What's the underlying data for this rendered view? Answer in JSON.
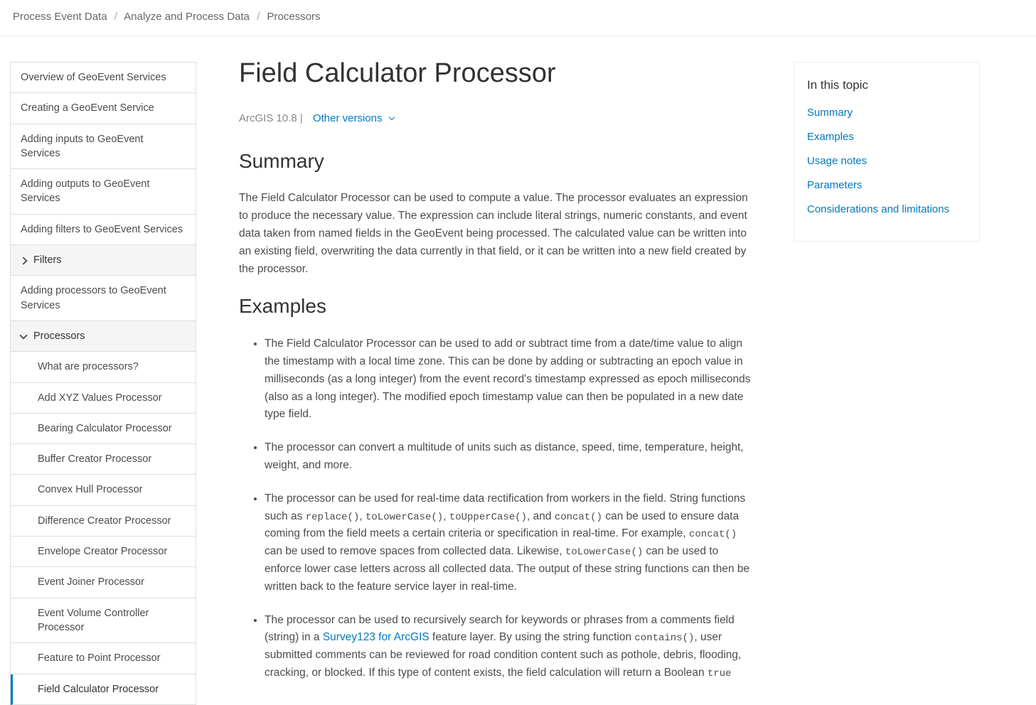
{
  "breadcrumb": {
    "a": "Process Event Data",
    "b": "Analyze and Process Data",
    "c": "Processors"
  },
  "sidebar": {
    "items": [
      "Overview of GeoEvent Services",
      "Creating a GeoEvent Service",
      "Adding inputs to GeoEvent Services",
      "Adding outputs to GeoEvent Services",
      "Adding filters to GeoEvent Services"
    ],
    "filters_label": "Filters",
    "add_proc_label": "Adding processors to GeoEvent Services",
    "processors_label": "Processors",
    "subs": [
      "What are processors?",
      "Add XYZ Values Processor",
      "Bearing Calculator Processor",
      "Buffer Creator Processor",
      "Convex Hull Processor",
      "Difference Creator Processor",
      "Envelope Creator Processor",
      "Event Joiner Processor",
      "Event Volume Controller Processor",
      "Feature to Point Processor",
      "Field Calculator Processor"
    ]
  },
  "main": {
    "title": "Field Calculator Processor",
    "version": "ArcGIS 10.8",
    "other_versions": "Other versions",
    "summary_h": "Summary",
    "summary_p": "The Field Calculator Processor can be used to compute a value. The processor evaluates an expression to produce the necessary value. The expression can include literal strings, numeric constants, and event data taken from named fields in the GeoEvent being processed. The calculated value can be written into an existing field, overwriting the data currently in that field, or it can be written into a new field created by the processor.",
    "examples_h": "Examples",
    "ex1": "The Field Calculator Processor can be used to add or subtract time from a date/time value to align the timestamp with a local time zone. This can be done by adding or subtracting an epoch value in milliseconds (as a long integer) from the event record's timestamp expressed as epoch milliseconds (also as a long integer). The modified epoch timestamp value can then be populated in a new date type field.",
    "ex2": "The processor can convert a multitude of units such as distance, speed, time, temperature, height, weight, and more.",
    "ex3_a": "The processor can be used for real-time data rectification from workers in the field. String functions such as ",
    "ex3_code1": "replace()",
    "ex3_b": ", ",
    "ex3_code2": "toLowerCase()",
    "ex3_c": ", ",
    "ex3_code3": "toUpperCase()",
    "ex3_d": ", and ",
    "ex3_code4": "concat()",
    "ex3_e": " can be used to ensure data coming from the field meets a certain criteria or specification in real-time. For example, ",
    "ex3_code5": "concat()",
    "ex3_f": " can be used to remove spaces from collected data. Likewise, ",
    "ex3_code6": "toLowerCase()",
    "ex3_g": " can be used to enforce lower case letters across all collected data. The output of these string functions can then be written back to the feature service layer in real-time.",
    "ex4_a": "The processor can be used to recursively search for keywords or phrases from a comments field (string) in a ",
    "ex4_link": "Survey123 for ArcGIS",
    "ex4_b": " feature layer. By using the string function ",
    "ex4_code1": "contains()",
    "ex4_c": ", user submitted comments can be reviewed for road condition content such as pothole, debris, flooding, cracking, or blocked. If this type of content exists, the field calculation will return a Boolean ",
    "ex4_code2": "true"
  },
  "toc": {
    "heading": "In this topic",
    "items": [
      "Summary",
      "Examples",
      "Usage notes",
      "Parameters",
      "Considerations and limitations"
    ]
  }
}
